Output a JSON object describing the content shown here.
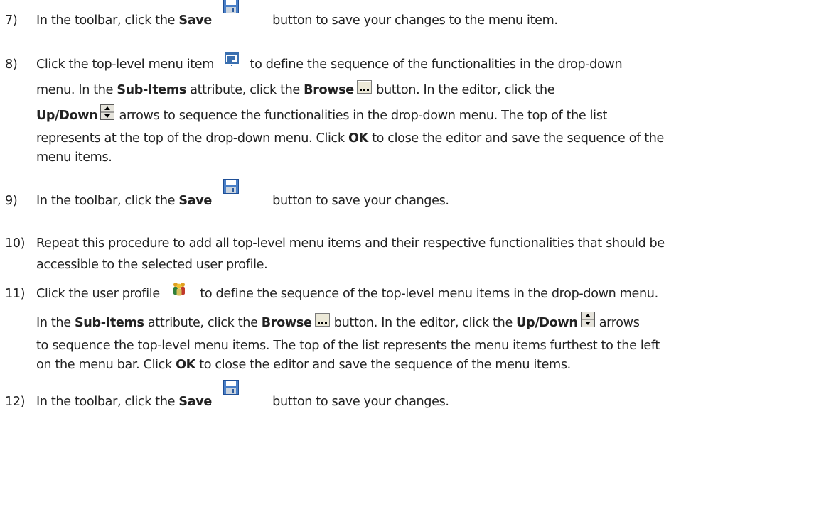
{
  "steps": [
    {
      "number": "7)",
      "lines": [
        [
          {
            "t": "In the toolbar, click the "
          },
          {
            "b": "Save"
          },
          {
            "icon": "save-icon"
          },
          {
            "t": " button to save your changes to the menu item."
          }
        ]
      ]
    },
    {
      "number": "8)",
      "lines": [
        [
          {
            "t": "Click the top-level menu item "
          },
          {
            "icon": "menu-item-icon"
          },
          {
            "t": " to define the sequence of the functionalities in the drop-down"
          }
        ],
        [
          {
            "t": "menu. In the "
          },
          {
            "b": "Sub-Items"
          },
          {
            "t": " attribute, click the "
          },
          {
            "b": "Browse"
          },
          {
            "icon": "browse-icon"
          },
          {
            "t": " button. In the editor, click the"
          }
        ],
        [
          {
            "b": "Up/Down"
          },
          {
            "icon": "up-down-icon"
          },
          {
            "t": " arrows to sequence the functionalities in the drop-down menu. The top of the list"
          }
        ],
        [
          {
            "t": "represents at the top of the drop-down menu. Click "
          },
          {
            "b": "OK"
          },
          {
            "t": " to close the editor and save the sequence of the"
          }
        ],
        [
          {
            "t": "menu items."
          }
        ]
      ]
    },
    {
      "number": "9)",
      "lines": [
        [
          {
            "t": "In the toolbar, click the "
          },
          {
            "b": "Save"
          },
          {
            "icon": "save-icon"
          },
          {
            "t": " button to save your changes."
          }
        ]
      ]
    },
    {
      "number": "10)",
      "lines": [
        [
          {
            "t": "Repeat this procedure to add all top-level menu items and their respective functionalities that should be"
          }
        ],
        [
          {
            "t": "accessible to the selected user profile."
          }
        ]
      ]
    },
    {
      "number": "11)",
      "lines": [
        [
          {
            "t": "Click the user profile "
          },
          {
            "icon": "user-profile-icon"
          },
          {
            "t": " to define the sequence of the top-level menu items in the drop-down menu."
          }
        ],
        [
          {
            "t": "In the "
          },
          {
            "b": "Sub-Items"
          },
          {
            "t": " attribute, click the "
          },
          {
            "b": "Browse"
          },
          {
            "icon": "browse-icon"
          },
          {
            "t": " button. In the editor, click the "
          },
          {
            "b": "Up/Down"
          },
          {
            "icon": "up-down-icon"
          },
          {
            "t": " arrows"
          }
        ],
        [
          {
            "t": "to sequence the top-level menu items. The top of the list represents the menu items furthest to the left"
          }
        ],
        [
          {
            "t": "on the menu bar. Click "
          },
          {
            "b": "OK"
          },
          {
            "t": " to close the editor and save the sequence of the menu items."
          }
        ]
      ]
    },
    {
      "number": "12)",
      "lines": [
        [
          {
            "t": "In the toolbar, click the "
          },
          {
            "b": "Save"
          },
          {
            "icon": "save-icon"
          },
          {
            "t": " button to save your changes."
          }
        ]
      ]
    }
  ]
}
